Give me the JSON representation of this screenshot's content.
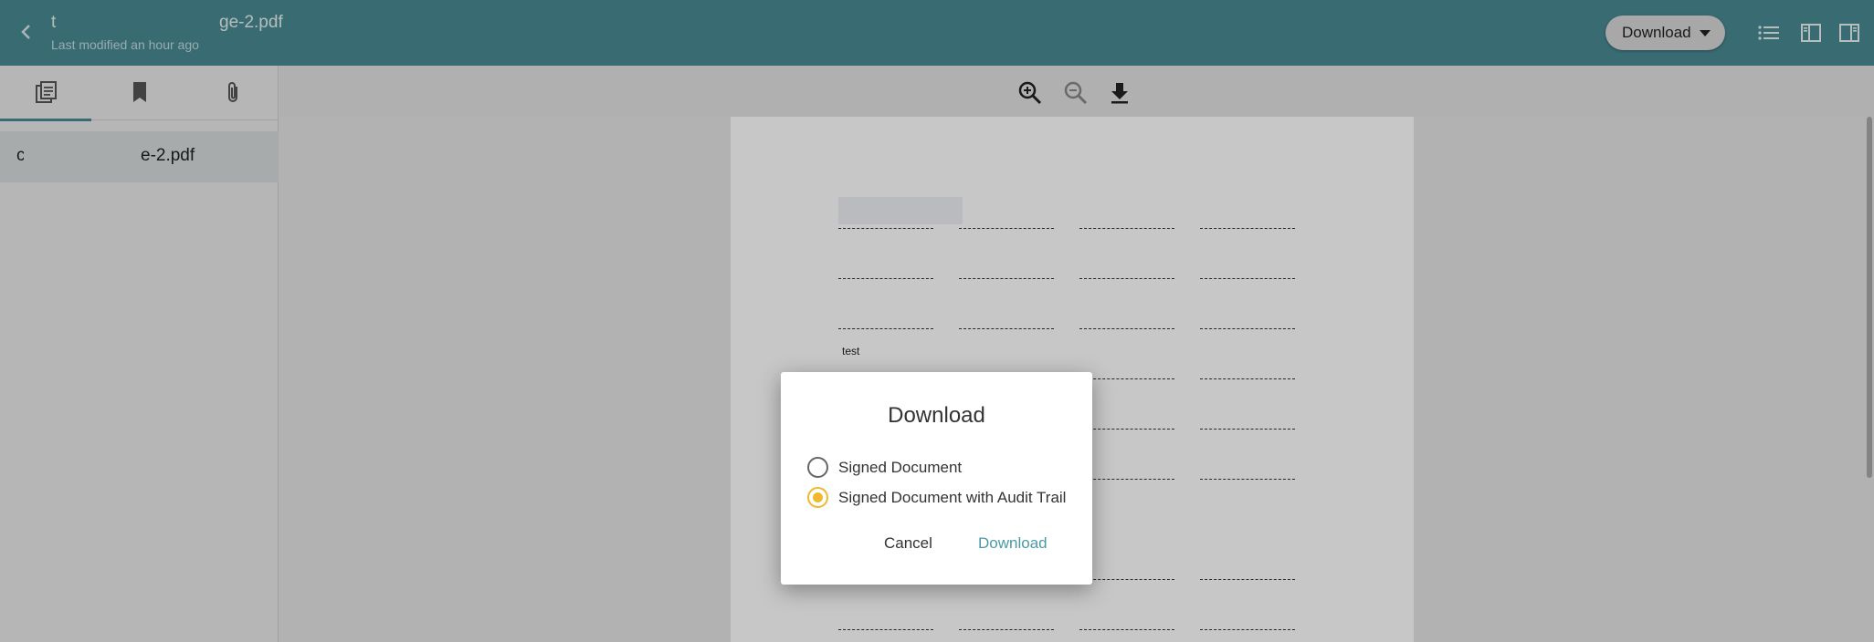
{
  "header": {
    "title_start": "t",
    "title_end": "ge-2.pdf",
    "subtitle": "Last modified an hour ago",
    "download_label": "Download",
    "icons": [
      "back-chevron-icon",
      "list-icon",
      "sidebar-left-icon",
      "sidebar-right-icon"
    ]
  },
  "sidebar": {
    "tabs": [
      {
        "name": "thumbnails",
        "icon": "pages-icon"
      },
      {
        "name": "bookmarks",
        "icon": "bookmark-icon"
      },
      {
        "name": "attachments",
        "icon": "paperclip-icon"
      }
    ],
    "file": {
      "name_start": "c",
      "name_end": "e-2.pdf"
    }
  },
  "toolbar": {
    "icons": [
      "zoom-in-icon",
      "zoom-out-icon",
      "download-icon"
    ]
  },
  "document": {
    "label": "test"
  },
  "dialog": {
    "title": "Download",
    "options": [
      {
        "label": "Signed Document",
        "selected": false
      },
      {
        "label": "Signed Document with Audit Trail",
        "selected": true
      }
    ],
    "cancel_label": "Cancel",
    "download_label": "Download"
  },
  "colors": {
    "header": "#4a8a94",
    "accent": "#f0b92e",
    "link": "#4a9aa6"
  }
}
